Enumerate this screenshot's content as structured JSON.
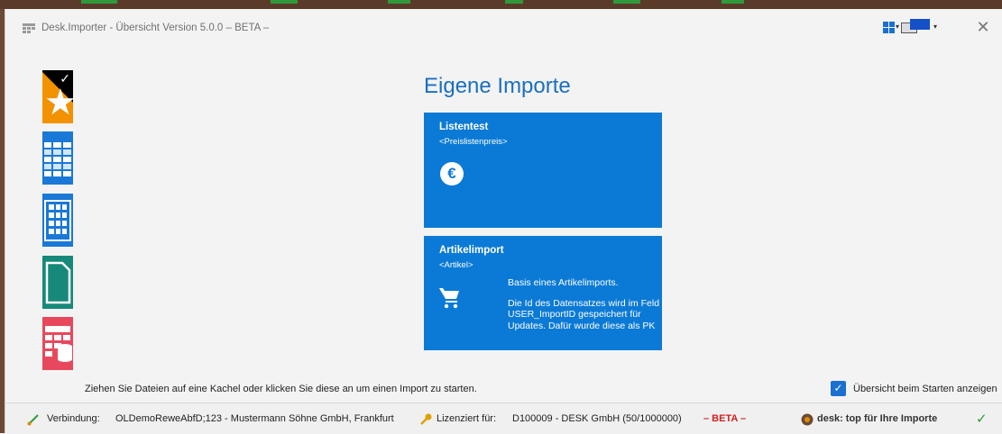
{
  "window": {
    "title": "Desk.Importer - Übersicht Version 5.0.0 – BETA –"
  },
  "main": {
    "title": "Eigene Importe",
    "tiles": [
      {
        "name": "Listentest",
        "sub": "<Preislistenpreis>",
        "icon": "euro-icon"
      },
      {
        "name": "Artikelimport",
        "sub": "<Artikel>",
        "icon": "cart-icon",
        "desc_1": "Basis eines Artikelimports.",
        "desc_2": "Die Id des Datensatzes wird im Feld USER_ImportID gespeichert für Updates. Dafür wurde diese als PK"
      }
    ]
  },
  "sidebar": {
    "items": [
      {
        "icon": "favorites-star-icon",
        "color": "#f39200"
      },
      {
        "icon": "list-view-icon",
        "color": "#1a78d6"
      },
      {
        "icon": "table-grid-icon",
        "color": "#1a78d6"
      },
      {
        "icon": "document-icon",
        "color": "#17897a"
      },
      {
        "icon": "database-table-icon",
        "color": "#e8485d"
      }
    ]
  },
  "footer": {
    "hint": "Ziehen Sie Dateien auf eine Kachel oder klicken Sie diese an um einen Import zu starten.",
    "checkbox_label": "Übersicht beim Starten anzeigen",
    "checkbox_checked": true
  },
  "statusbar": {
    "connection_label": "Verbindung:",
    "connection_value": "OLDemoReweAbfD;123 - Mustermann  Söhne GmbH, Frankfurt",
    "license_label": "Lizenziert für:",
    "license_value": "D100009 - DESK GmbH (50/1000000)",
    "beta": "– BETA –",
    "brand": "desk: top für Ihre Importe"
  },
  "colors": {
    "accent": "#0b7ad6",
    "title": "#1a6fc0",
    "beta": "#d12020"
  }
}
